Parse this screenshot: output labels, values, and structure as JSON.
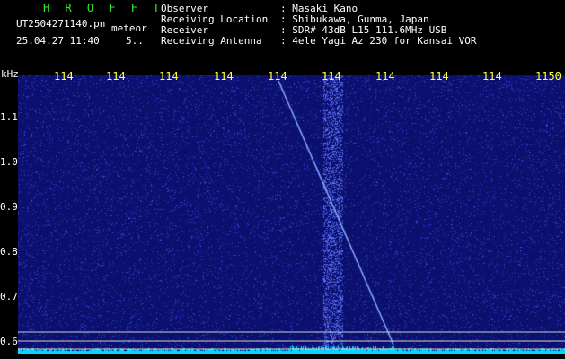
{
  "header": {
    "program": "H R O F F T",
    "filename": "UT2504271140.pn",
    "tag": "meteor",
    "datetime": "25.04.27 11:40",
    "extra": "5..",
    "fields": [
      {
        "label": "Observer",
        "value": ": Masaki Kano"
      },
      {
        "label": "Receiving Location",
        "value": ": Shibukawa, Gunma, Japan"
      },
      {
        "label": "Receiver",
        "value": ": SDR# 43dB L15 111.6MHz USB"
      },
      {
        "label": "Receiving Antenna",
        "value": ": 4ele Yagi Az 230 for Kansai VOR"
      }
    ]
  },
  "axis": {
    "unit": "kHz",
    "x_ticks": [
      "114",
      "114",
      "114",
      "114",
      "114",
      "114",
      "114",
      "114",
      "114",
      "1150"
    ],
    "y_ticks": [
      "1.1",
      "1.0",
      "0.9",
      "0.8",
      "0.7",
      "0.6"
    ]
  },
  "colors": {
    "background": "#0b0f6e",
    "noise": "#3a46d8",
    "trace": "#8fb6ff",
    "baseline": "#00d8ff",
    "tick_label": "#ffff44",
    "title": "#33ee33"
  }
}
